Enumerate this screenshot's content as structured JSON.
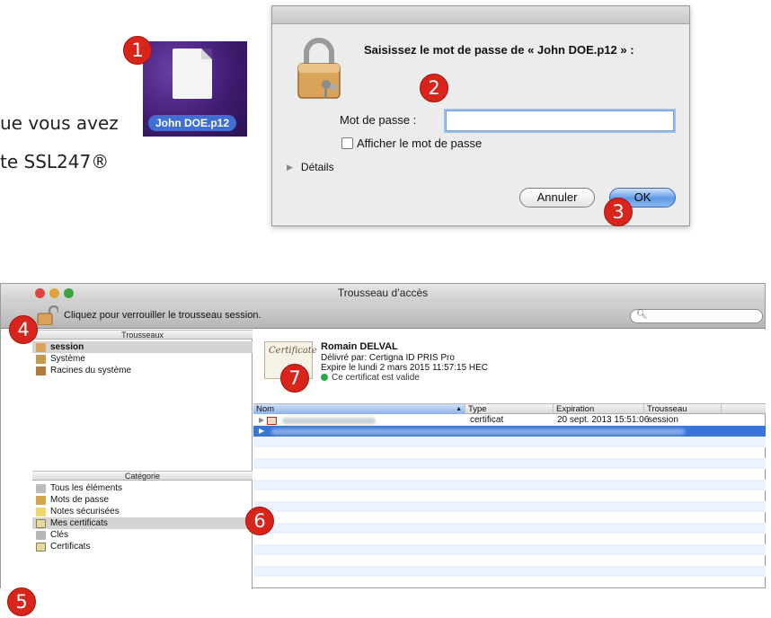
{
  "background": {
    "text_line1": "ue vous avez",
    "text_line2": "te SSL247®",
    "text_line3": "»"
  },
  "badges": [
    "1",
    "2",
    "3",
    "4",
    "5",
    "6",
    "7"
  ],
  "file": {
    "name": "John DOE.p12"
  },
  "password_dialog": {
    "title": "Saisissez le mot de passe de « John DOE.p12 » :",
    "password_label": "Mot de passe :",
    "password_value": "",
    "show_password_label": "Afficher le mot de passe",
    "details_label": "Détails",
    "cancel_label": "Annuler",
    "ok_label": "OK"
  },
  "keychain": {
    "window_title": "Trousseau d’accès",
    "lock_text": "Cliquez pour verrouiller le trousseau session.",
    "search_value": "",
    "keychains_header": "Trousseaux",
    "keychains": [
      "session",
      "Système",
      "Racines du système"
    ],
    "category_header": "Catégorie",
    "categories": [
      "Tous les éléments",
      "Mots de passe",
      "Notes sécurisées",
      "Mes certificats",
      "Clés",
      "Certificats"
    ],
    "certificate": {
      "thumb_text": "Certificate",
      "name": "Romain DELVAL",
      "issuer": "Délivré par: Certigna ID PRIS Pro",
      "expires": "Expire le lundi 2 mars 2015 11:57:15 HEC",
      "status": "Ce certificat est valide"
    },
    "columns": [
      "Nom",
      "Type",
      "Expiration",
      "Trousseau"
    ],
    "rows": [
      {
        "type": "certificat",
        "expiration": "20 sept. 2013 15:51:06",
        "keychain": "session"
      }
    ]
  },
  "colors": {
    "badge": "#d9241b",
    "selection": "#3875d7",
    "valid": "#2aa84a"
  }
}
